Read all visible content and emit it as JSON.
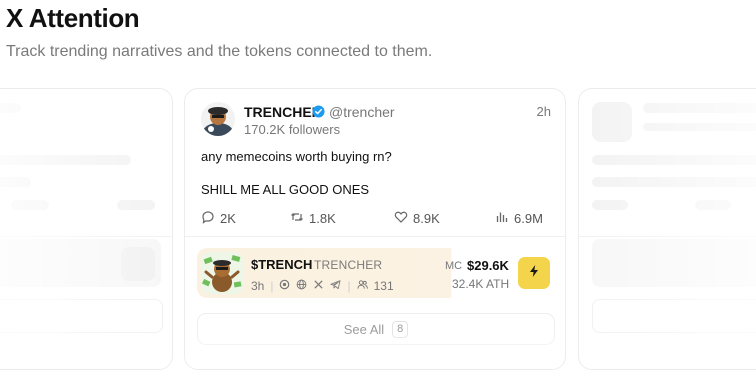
{
  "header": {
    "title": "X Attention",
    "subtitle": "Track trending narratives and the tokens connected to them."
  },
  "post": {
    "author_name": "TRENCHER",
    "handle": "@trencher",
    "followers": "170.2K followers",
    "time": "2h",
    "text_line_1": "any memecoins worth buying rn?",
    "text_line_2": "SHILL ME ALL GOOD ONES",
    "stats": {
      "replies": "2K",
      "reposts": "1.8K",
      "likes": "8.9K",
      "views": "6.9M"
    }
  },
  "token": {
    "symbol": "$TRENCH",
    "name": "TRENCHER",
    "age": "3h",
    "holders": "131",
    "mc_label": "MC",
    "mc_value": "$29.6K",
    "ath": "32.4K ATH",
    "accent_color": "#f4d44a"
  },
  "see_all": {
    "label": "See All",
    "count": "8"
  },
  "icons": [
    "verified-badge-icon",
    "reply-icon",
    "repost-icon",
    "like-icon",
    "views-icon",
    "pump-icon",
    "globe-icon",
    "x-icon",
    "telegram-icon",
    "holders-icon",
    "bolt-icon"
  ]
}
